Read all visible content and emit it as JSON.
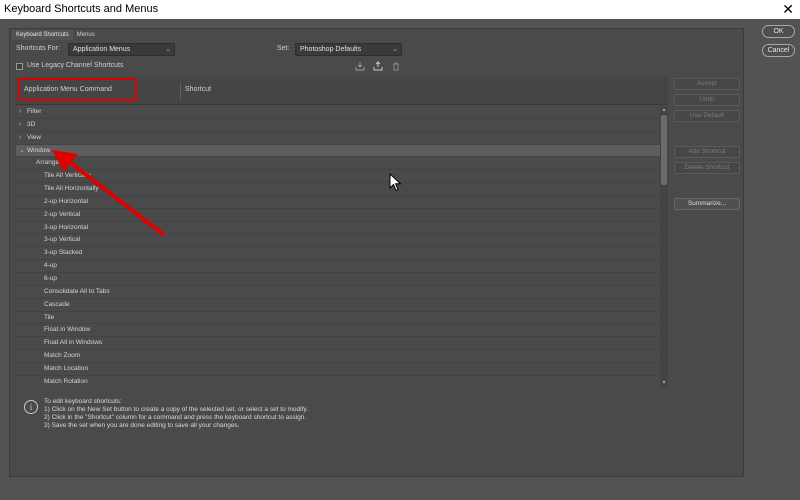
{
  "window": {
    "title": "Keyboard Shortcuts and Menus",
    "close_glyph": "✕"
  },
  "tabs": [
    "Keyboard Shortcuts",
    "Menus"
  ],
  "shortcuts_for": {
    "label": "Shortcuts For:",
    "value": "Application Menus"
  },
  "set": {
    "label": "Set:",
    "value": "Photoshop Defaults"
  },
  "legacy_checkbox": {
    "label": "Use Legacy Channel Shortcuts",
    "checked": false
  },
  "table": {
    "col_command": "Application Menu Command",
    "col_shortcut": "Shortcut",
    "rows": [
      {
        "label": "Filter",
        "arrow": "›",
        "indent": "group",
        "selected": false
      },
      {
        "label": "3D",
        "arrow": "›",
        "indent": "group",
        "selected": false
      },
      {
        "label": "View",
        "arrow": "›",
        "indent": "group",
        "selected": false
      },
      {
        "label": "Window",
        "arrow": "⌄",
        "indent": "group",
        "selected": true
      },
      {
        "label": "Arrange:",
        "arrow": "",
        "indent": "sub",
        "selected": false
      },
      {
        "label": "Tile All Vertically",
        "arrow": "",
        "indent": "item",
        "selected": false
      },
      {
        "label": "Tile All Horizontally",
        "arrow": "",
        "indent": "item",
        "selected": false
      },
      {
        "label": "2-up Horizontal",
        "arrow": "",
        "indent": "item",
        "selected": false
      },
      {
        "label": "2-up Vertical",
        "arrow": "",
        "indent": "item",
        "selected": false
      },
      {
        "label": "3-up Horizontal",
        "arrow": "",
        "indent": "item",
        "selected": false
      },
      {
        "label": "3-up Vertical",
        "arrow": "",
        "indent": "item",
        "selected": false
      },
      {
        "label": "3-up Stacked",
        "arrow": "",
        "indent": "item",
        "selected": false
      },
      {
        "label": "4-up",
        "arrow": "",
        "indent": "item",
        "selected": false
      },
      {
        "label": "6-up",
        "arrow": "",
        "indent": "item",
        "selected": false
      },
      {
        "label": "Consolidate All to Tabs",
        "arrow": "",
        "indent": "item",
        "selected": false
      },
      {
        "label": "Cascade",
        "arrow": "",
        "indent": "item",
        "selected": false
      },
      {
        "label": "Tile",
        "arrow": "",
        "indent": "item",
        "selected": false
      },
      {
        "label": "Float in Window",
        "arrow": "",
        "indent": "item",
        "selected": false
      },
      {
        "label": "Float All in Windows",
        "arrow": "",
        "indent": "item",
        "selected": false
      },
      {
        "label": "Match Zoom",
        "arrow": "",
        "indent": "item",
        "selected": false
      },
      {
        "label": "Match Location",
        "arrow": "",
        "indent": "item",
        "selected": false
      },
      {
        "label": "Match Rotation",
        "arrow": "",
        "indent": "item",
        "selected": false
      }
    ]
  },
  "side_buttons": {
    "accept": "Accept",
    "undo": "Undo",
    "use_default": "Use Default",
    "add_shortcut": "Add Shortcut",
    "delete_shortcut": "Delete Shortcut",
    "summarize": "Summarize..."
  },
  "dialog_buttons": {
    "ok": "OK",
    "cancel": "Cancel"
  },
  "help": {
    "icon_glyph": "i",
    "lines": [
      "To edit keyboard shortcuts:",
      "1) Click on the New Set button to create a copy of the selected set, or select a set to modify.",
      "2) Click in the \"Shortcut\" column for a command and press the keyboard shortcut to assign.",
      "3) Save the set when you are done editing to save all your changes."
    ]
  },
  "icons": {
    "save_set": "save-set-icon",
    "new_set": "new-set-icon",
    "delete_set": "trash-icon"
  },
  "colors": {
    "annotation": "#e00000",
    "background": "#535353"
  }
}
